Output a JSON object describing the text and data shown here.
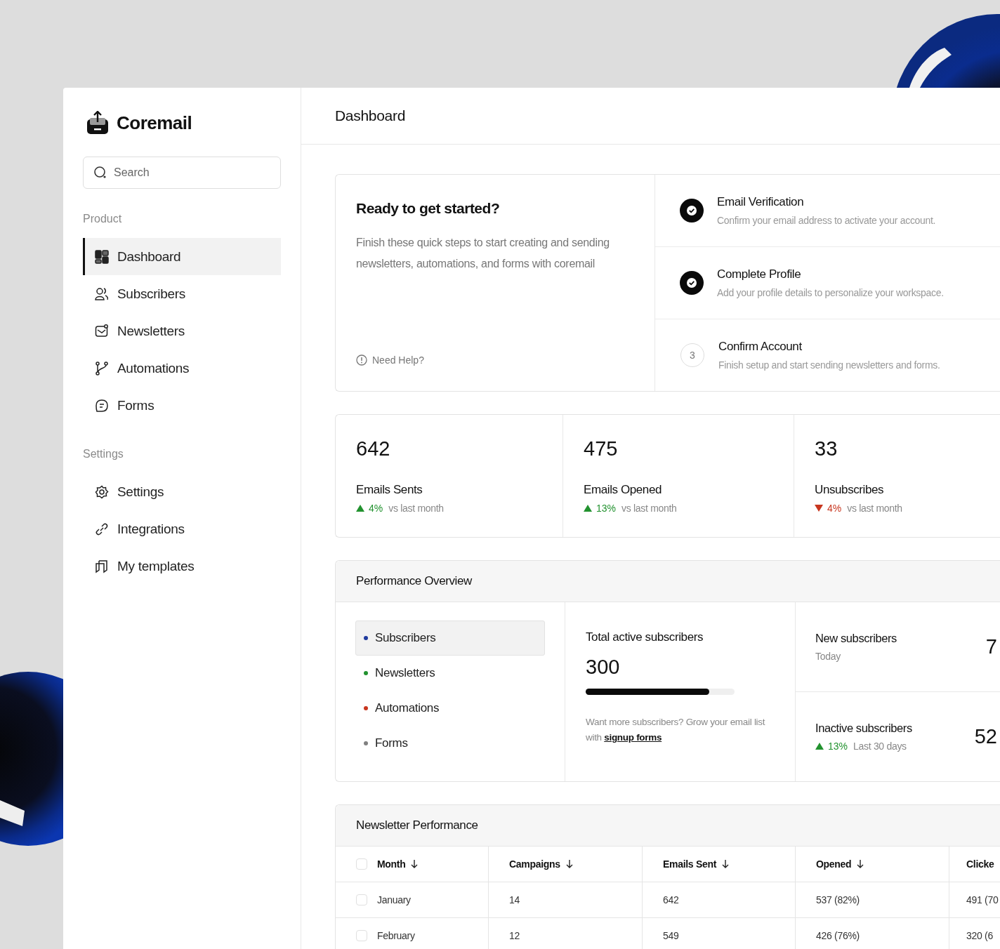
{
  "sidebar": {
    "brand": "Coremail",
    "search": {
      "placeholder": "Search"
    },
    "sections": [
      {
        "title": "Product",
        "items": [
          {
            "label": "Dashboard",
            "selected": true
          },
          {
            "label": "Subscribers",
            "selected": false
          },
          {
            "label": "Newsletters",
            "selected": false
          },
          {
            "label": "Automations",
            "selected": false
          },
          {
            "label": "Forms",
            "selected": false
          }
        ]
      },
      {
        "title": "Settings",
        "items": [
          {
            "label": "Settings",
            "selected": false
          },
          {
            "label": "Integrations",
            "selected": false
          },
          {
            "label": "My templates",
            "selected": false
          }
        ]
      }
    ]
  },
  "header": {
    "title": "Dashboard"
  },
  "getting_started": {
    "title": "Ready to get started?",
    "text": "Finish these quick steps to start creating and sending newsletters, automations, and forms with coremail",
    "help": "Need Help?",
    "steps": [
      {
        "title": "Email Verification",
        "text": "Confirm your email address to activate your account.",
        "done": true
      },
      {
        "title": "Complete Profile",
        "text": "Add your profile details to personalize your workspace.",
        "done": true
      },
      {
        "number": "3",
        "title": "Confirm Account",
        "text": "Finish setup and start sending newsletters and forms.",
        "done": false
      }
    ]
  },
  "stats": [
    {
      "value": "642",
      "label": "Emails Sents",
      "change": "4%",
      "rising": true,
      "note": "vs last month"
    },
    {
      "value": "475",
      "label": "Emails Opened",
      "change": "13%",
      "rising": true,
      "note": "vs last month"
    },
    {
      "value": "33",
      "label": "Unsubscribes",
      "change": "4%",
      "rising": false,
      "note": "vs last month"
    }
  ],
  "performance": {
    "title": "Performance Overview",
    "tabs": [
      {
        "label": "Subscribers",
        "color": "#1f3a9e",
        "selected": true
      },
      {
        "label": "Newsletters",
        "color": "#22922f",
        "selected": false
      },
      {
        "label": "Automations",
        "color": "#c8361f",
        "selected": false
      },
      {
        "label": "Forms",
        "color": "#808080",
        "selected": false
      }
    ],
    "total": {
      "label": "Total active subscribers",
      "value": "300",
      "level": 0.83,
      "note": "Want more subscribers? Grow your email list with",
      "link": "signup forms"
    },
    "metrics": [
      {
        "label": "New subscribers",
        "sub": "Today",
        "value": "7"
      },
      {
        "label": "Inactive subscribers",
        "change": "13%",
        "rising": true,
        "sub": "Last 30 days",
        "value": "52"
      }
    ]
  },
  "table": {
    "title": "Newsletter Performance",
    "header_checked": false,
    "columns": [
      {
        "label": "Month",
        "sortable": true
      },
      {
        "label": "Campaigns",
        "sortable": true
      },
      {
        "label": "Emails Sent",
        "sortable": true
      },
      {
        "label": "Opened",
        "sortable": true
      },
      {
        "label": "Clicke",
        "sortable": false
      }
    ],
    "rows": [
      {
        "checked": false,
        "cells": [
          "January",
          "14",
          "642",
          "537 (82%)",
          "491 (70"
        ]
      },
      {
        "checked": false,
        "cells": [
          "February",
          "12",
          "549",
          "426 (76%)",
          "320 (6"
        ]
      }
    ]
  }
}
